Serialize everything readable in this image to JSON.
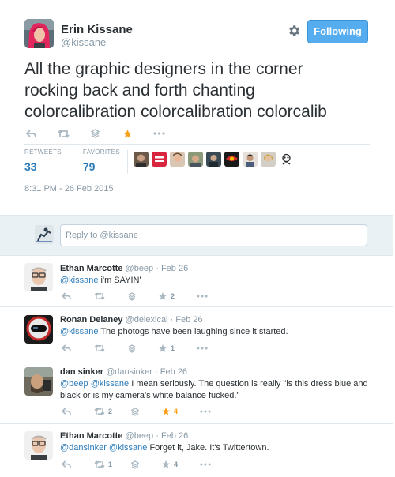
{
  "author": {
    "name": "Erin Kissane",
    "handle": "@kissane",
    "follow_label": "Following"
  },
  "tweet": {
    "text_lines": [
      "All the graphic designers in the corner",
      "rocking back and forth chanting",
      "colorcalibration colorcalibration colorcalib"
    ],
    "stats": {
      "retweets_label": "RETWEETS",
      "retweets": "33",
      "favorites_label": "FAVORITES",
      "favorites": "79"
    },
    "timestamp": "8:31 PM - 26 Feb 2015"
  },
  "reply_box": {
    "placeholder": "Reply to ",
    "mention": "@kissane"
  },
  "replies": [
    {
      "name": "Ethan Marcotte",
      "handle": "@beep",
      "date": "· Feb 26",
      "mention": "@kissane",
      "text": " i'm SAYIN'",
      "retweets": "",
      "favorites": "2",
      "favorited": false
    },
    {
      "name": "Ronan Delaney",
      "handle": "@delexical",
      "date": "· Feb 26",
      "mention": "@kissane",
      "text": " The photogs have been laughing since it started.",
      "retweets": "",
      "favorites": "1",
      "favorited": false
    },
    {
      "name": "dan sinker",
      "handle": "@dansinker",
      "date": "· Feb 26",
      "mentions": "@beep @kissane",
      "text_line1": " I mean seriously. The question is really \"is this dress blue and",
      "text_line2": "black or is my camera's white balance fucked.\"",
      "retweets": "2",
      "favorites": "4",
      "favorited": true
    },
    {
      "name": "Ethan Marcotte",
      "handle": "@beep",
      "date": "· Feb 26",
      "mentions": "@dansinker @kissane",
      "text": " Forget it, Jake. It's Twittertown.",
      "retweets": "1",
      "favorites": "4",
      "favorited": false
    }
  ],
  "colors": {
    "accent": "#55acee",
    "link": "#2b7bb9",
    "favorite": "#f9a11a",
    "muted": "#8899a6"
  },
  "icons": [
    "settings-gear-icon",
    "reply-icon",
    "retweet-icon",
    "stack-icon",
    "favorite-star-icon",
    "more-icon"
  ]
}
